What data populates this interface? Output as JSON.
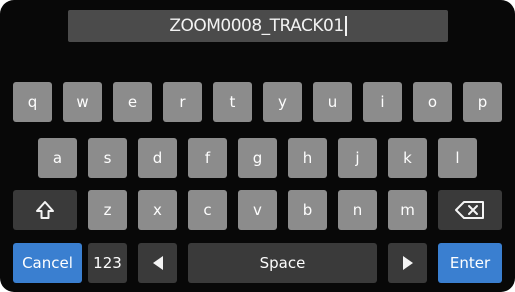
{
  "name_field": {
    "value": "ZOOM0008_TRACK01"
  },
  "keyboard": {
    "row1": [
      "q",
      "w",
      "e",
      "r",
      "t",
      "y",
      "u",
      "i",
      "o",
      "p"
    ],
    "row2": [
      "a",
      "s",
      "d",
      "f",
      "g",
      "h",
      "j",
      "k",
      "l"
    ],
    "row3": [
      "z",
      "x",
      "c",
      "v",
      "b",
      "n",
      "m"
    ],
    "shift_icon": "shift-up-arrow-icon",
    "backspace_icon": "backspace-icon",
    "cancel_label": "Cancel",
    "numbers_label": "123",
    "left_icon": "left-triangle-icon",
    "space_label": "Space",
    "right_icon": "right-triangle-icon",
    "enter_label": "Enter"
  },
  "colors": {
    "background": "#080808",
    "key": "#8c8c8c",
    "dark_key": "#3a3a3a",
    "accent": "#3a7fd0",
    "field": "#4b4b4b"
  }
}
